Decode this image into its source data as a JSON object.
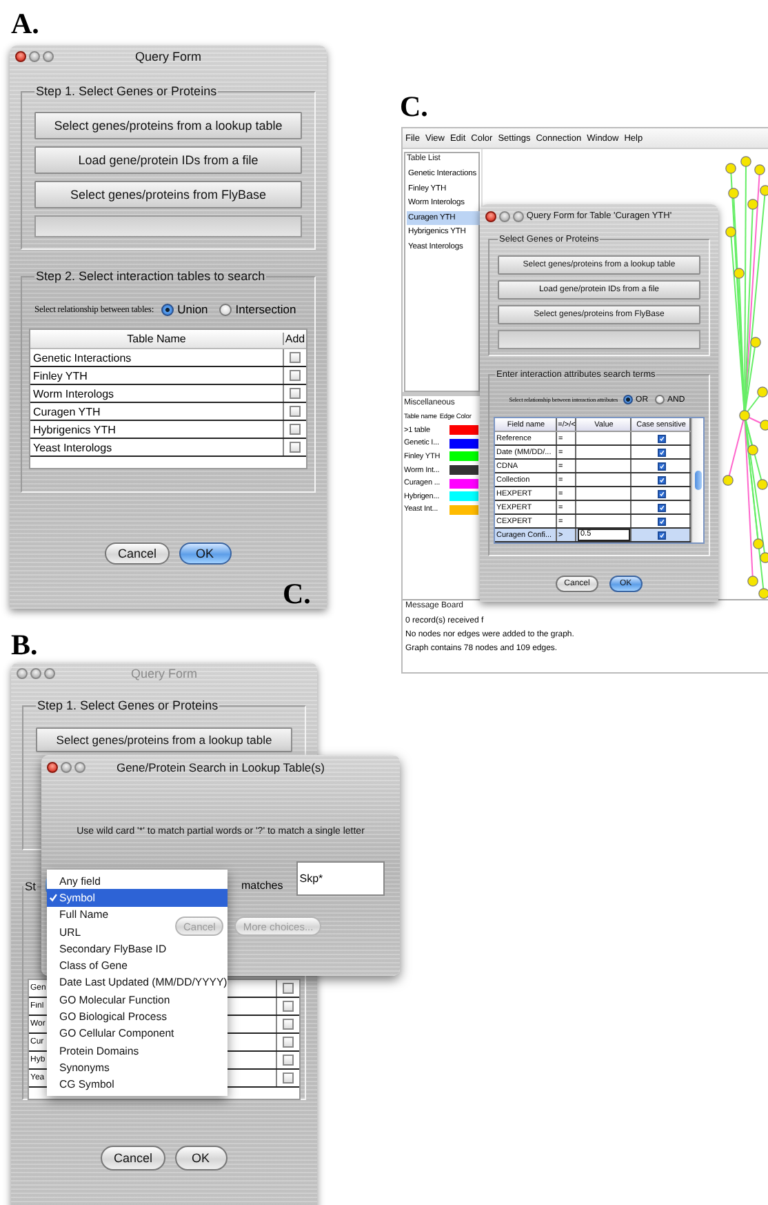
{
  "panel_a": {
    "label": "A.",
    "window": {
      "title": "Query Form",
      "active": true,
      "step1": {
        "title": "Step 1. Select Genes or Proteins",
        "buttons": [
          "Select genes/proteins from a lookup table",
          "Load gene/protein IDs from a file",
          "Select genes/proteins from FlyBase"
        ]
      },
      "step2": {
        "title": "Step 2. Select interaction tables to search",
        "relationship": {
          "label": "Select relationship between tables:",
          "options": [
            {
              "label": "Union",
              "selected": true
            },
            {
              "label": "Intersection",
              "selected": false
            }
          ]
        },
        "table": {
          "columns": [
            "Table Name",
            "Add"
          ],
          "rows": [
            {
              "name": "Genetic Interactions",
              "checked": false
            },
            {
              "name": "Finley YTH",
              "checked": false
            },
            {
              "name": "Worm Interologs",
              "checked": false
            },
            {
              "name": "Curagen YTH",
              "checked": false
            },
            {
              "name": "Hybrigenics YTH",
              "checked": false
            },
            {
              "name": "Yeast Interologs",
              "checked": false
            }
          ]
        }
      },
      "actions": [
        {
          "label": "Cancel",
          "default": false
        },
        {
          "label": "OK",
          "default": true
        }
      ]
    },
    "overlay_label": "C."
  },
  "panel_c": {
    "label": "C.",
    "menu": [
      "File",
      "View",
      "Edit",
      "Color",
      "Settings",
      "Connection",
      "Window",
      "Help"
    ],
    "table_list": {
      "title": "Table List",
      "items": [
        {
          "label": "Genetic Interactions",
          "selected": false
        },
        {
          "label": "Finley YTH",
          "selected": false
        },
        {
          "label": "Worm Interologs",
          "selected": false
        },
        {
          "label": "Curagen YTH",
          "selected": true
        },
        {
          "label": "Hybrigenics YTH",
          "selected": false
        },
        {
          "label": "Yeast Interologs",
          "selected": false
        }
      ]
    },
    "miscellaneous": {
      "title": "Miscellaneous",
      "columns": [
        "Table name",
        "Edge Color"
      ],
      "rows": [
        {
          "name": ">1 table",
          "color": "#ff0000"
        },
        {
          "name": "Genetic I...",
          "color": "#0000ff"
        },
        {
          "name": "Finley YTH",
          "color": "#00ff00"
        },
        {
          "name": "Worm Int...",
          "color": "#333333"
        },
        {
          "name": "Curagen ...",
          "color": "#ff00ff"
        },
        {
          "name": "Hybrigen...",
          "color": "#00ffff"
        },
        {
          "name": "Yeast Int...",
          "color": "#ffbb00"
        }
      ]
    },
    "message_board": {
      "title": "Message Board",
      "lines": [
        "0 record(s) received f",
        "No nodes nor edges were added to the graph.",
        "Graph contains 78 nodes and 109 edges."
      ]
    },
    "dialog": {
      "title": "Query Form for Table 'Curagen YTH'",
      "active": true,
      "section1": {
        "title": "Select Genes or Proteins",
        "buttons": [
          "Select genes/proteins from a lookup table",
          "Load gene/protein IDs from a file",
          "Select genes/proteins from FlyBase"
        ]
      },
      "section2": {
        "title": "Enter interaction attributes search terms",
        "relationship": {
          "label": "Select relationship between interaction attributes",
          "options": [
            {
              "label": "OR",
              "selected": true
            },
            {
              "label": "AND",
              "selected": false
            }
          ]
        },
        "table": {
          "columns": [
            "Field name",
            "=/>/<",
            "Value",
            "Case sensitive"
          ],
          "rows": [
            {
              "field": "Reference",
              "op": "=",
              "checked": true,
              "selected": false
            },
            {
              "field": "Date (MM/DD/...",
              "op": "=",
              "checked": true,
              "selected": false
            },
            {
              "field": "CDNA",
              "op": "=",
              "checked": true,
              "selected": false
            },
            {
              "field": "Collection",
              "op": "=",
              "checked": true,
              "selected": false
            },
            {
              "field": "HEXPERT",
              "op": "=",
              "checked": true,
              "selected": false
            },
            {
              "field": "YEXPERT",
              "op": "=",
              "checked": true,
              "selected": false
            },
            {
              "field": "CEXPERT",
              "op": "=",
              "checked": true,
              "selected": false
            },
            {
              "field": "Curagen Confi...",
              "op": ">",
              "value": "0.5",
              "checked": true,
              "selected": true
            }
          ]
        }
      },
      "actions": [
        {
          "label": "Cancel",
          "default": false
        },
        {
          "label": "OK",
          "default": true
        }
      ]
    }
  },
  "panel_b": {
    "label": "B.",
    "window": {
      "title": "Query Form",
      "active": false,
      "step1": {
        "title": "Step 1. Select Genes or Proteins",
        "buttons": [
          "Select genes/proteins from a lookup table"
        ]
      },
      "step2": {
        "title": "St",
        "rows": [
          {
            "name": "Gen",
            "checked": false
          },
          {
            "name": "Finl",
            "checked": false
          },
          {
            "name": "Wor",
            "checked": false
          },
          {
            "name": "Cur",
            "checked": false
          },
          {
            "name": "Hyb",
            "checked": false
          },
          {
            "name": "Yea",
            "checked": false
          }
        ]
      },
      "actions": [
        {
          "label": "Cancel",
          "default": false
        },
        {
          "label": "OK",
          "default": false
        }
      ]
    },
    "dialog": {
      "title": "Gene/Protein Search in Lookup Table(s)",
      "active": true,
      "hint": "Use wild card '*' to match partial words or '?' to match a single letter",
      "matches_label": "matches",
      "value": "Skp*",
      "buttons": [
        {
          "label": "Cancel",
          "disabled": true
        },
        {
          "label": "More choices...",
          "disabled": true
        }
      ],
      "field_menu": {
        "items": [
          {
            "label": "Any field",
            "selected": false
          },
          {
            "label": "Symbol",
            "selected": true
          },
          {
            "label": "Full Name",
            "selected": false
          },
          {
            "label": "URL",
            "selected": false
          },
          {
            "label": "Secondary FlyBase ID",
            "selected": false
          },
          {
            "label": "Class of Gene",
            "selected": false
          },
          {
            "label": "Date Last Updated (MM/DD/YYYY)",
            "selected": false
          },
          {
            "label": "GO Molecular Function",
            "selected": false
          },
          {
            "label": "GO Biological Process",
            "selected": false
          },
          {
            "label": "GO Cellular Component",
            "selected": false
          },
          {
            "label": "Protein Domains",
            "selected": false
          },
          {
            "label": "Synonyms",
            "selected": false
          },
          {
            "label": "CG Symbol",
            "selected": false
          }
        ]
      }
    }
  }
}
